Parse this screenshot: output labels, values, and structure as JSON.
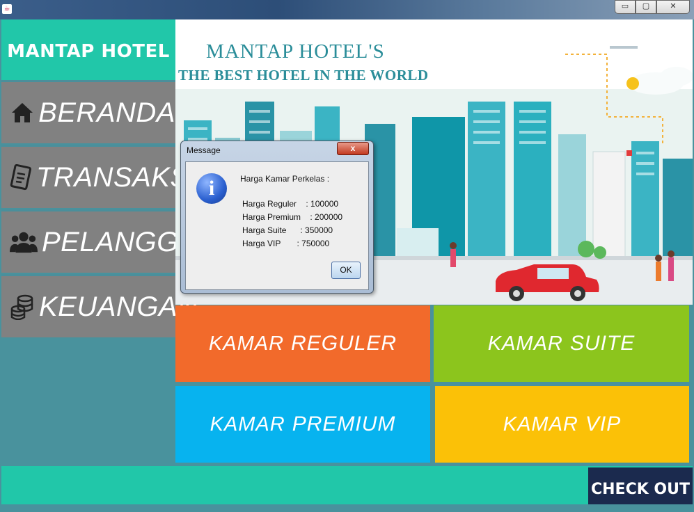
{
  "window": {
    "minimize": "▭",
    "maximize": "▢",
    "close": "✕"
  },
  "sidebar": {
    "brand": "MANTAP HOTEL",
    "items": [
      {
        "label": "BERANDA",
        "icon": "home-icon"
      },
      {
        "label": "TRANSAKSI",
        "icon": "document-icon"
      },
      {
        "label": "PELANGGAN",
        "icon": "users-icon"
      },
      {
        "label": "KEUANGAN",
        "icon": "coins-icon"
      }
    ]
  },
  "hero": {
    "title": "MANTAP HOTEL'S",
    "subtitle": "THE BEST HOTEL IN THE WORLD"
  },
  "tiles": [
    {
      "prefix": "KAMAR",
      "name": "REGULER",
      "color": "#f26a2b"
    },
    {
      "prefix": "KAMAR",
      "name": "SUITE",
      "color": "#8cc51d"
    },
    {
      "prefix": "KAMAR",
      "name": "PREMIUM",
      "color": "#07b3ef"
    },
    {
      "prefix": "KAMAR",
      "name": "VIP",
      "color": "#fbc107"
    }
  ],
  "checkout": "CHECK OUT",
  "dialog": {
    "title": "Message",
    "close": "x",
    "heading": "Harga Kamar Perkelas :",
    "lines": [
      "Harga Reguler    : 100000",
      "Harga Premium    : 200000",
      "Harga Suite      : 350000",
      "Harga VIP       : 750000"
    ],
    "ok": "OK"
  },
  "colors": {
    "brand": "#21c7a9",
    "sidebar_item": "#818181",
    "sidebar_bg": "#49929d",
    "checkout_bg": "#1b2a4e"
  }
}
